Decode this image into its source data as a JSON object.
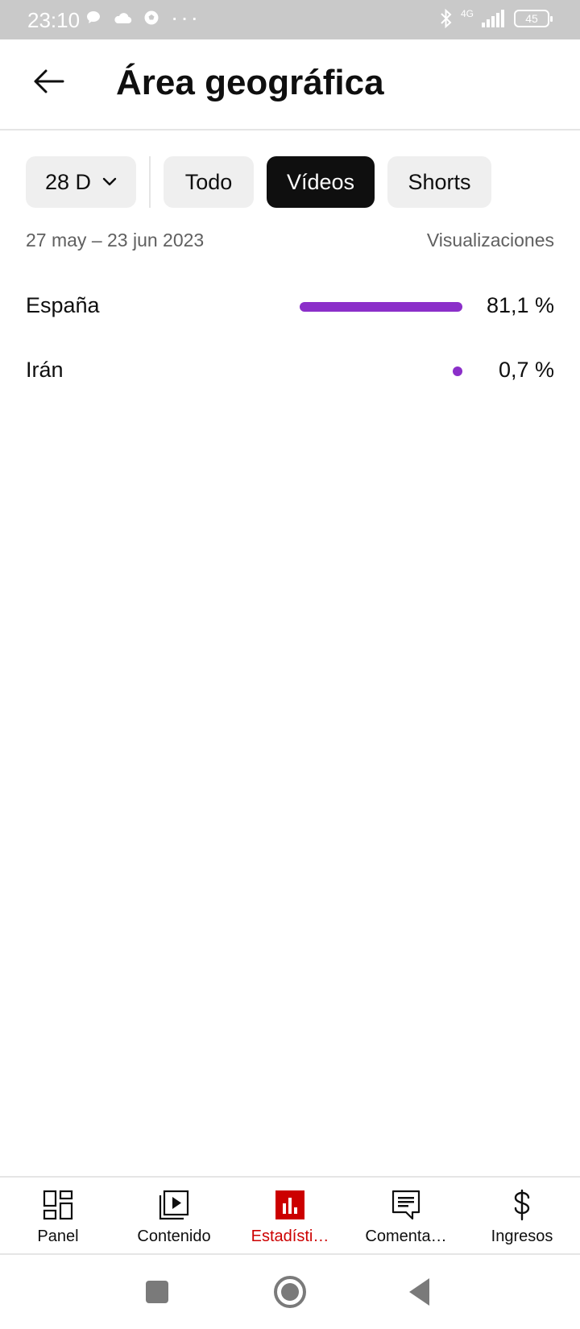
{
  "status_bar": {
    "time": "23:10",
    "network": "4G",
    "battery": "45",
    "icons": [
      "chat-bubble-icon",
      "cloud-icon",
      "soccer-ball-icon",
      "more-dots-icon",
      "bluetooth-icon",
      "signal-icon",
      "battery-icon"
    ]
  },
  "header": {
    "title": "Área geográfica",
    "back_icon": "arrow-left-icon"
  },
  "filters": {
    "period": "28 D",
    "chips": [
      "Todo",
      "Vídeos",
      "Shorts"
    ],
    "selected": "Vídeos"
  },
  "report": {
    "date_range": "27 may – 23 jun 2023",
    "metric": "Visualizaciones",
    "bar_color": "#8b2fc9",
    "rows": [
      {
        "country": "España",
        "value": "81,1 %",
        "share": 81.1
      },
      {
        "country": "Irán",
        "value": "0,7 %",
        "share": 0.7
      }
    ]
  },
  "bottom_nav": {
    "active_color": "#cc0000",
    "items": [
      {
        "label": "Panel",
        "icon": "dashboard-icon"
      },
      {
        "label": "Contenido",
        "icon": "content-icon"
      },
      {
        "label": "Estadísti…",
        "icon": "analytics-icon",
        "active": true
      },
      {
        "label": "Comenta…",
        "icon": "comments-icon"
      },
      {
        "label": "Ingresos",
        "icon": "dollar-icon"
      }
    ]
  },
  "system_nav": [
    "recents-icon",
    "home-icon",
    "back-triangle-icon"
  ]
}
